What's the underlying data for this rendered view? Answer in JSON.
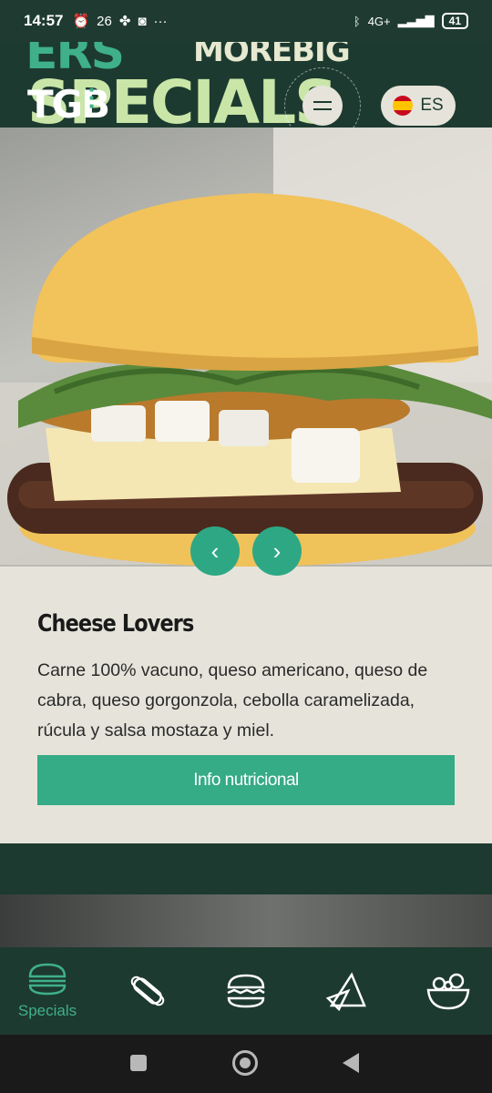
{
  "status_bar": {
    "time": "14:57",
    "temperature": "26",
    "network": "4G+",
    "battery": "41"
  },
  "header": {
    "banner_line1_left": "ERS",
    "banner_line1_right": "MOREBIG",
    "banner_line2": "SPECIALS",
    "logo": "TGB",
    "menu_ring_text": "menu",
    "language": "ES"
  },
  "product": {
    "name": "Cheese Lovers",
    "description": "Carne 100% vacuno, queso americano, queso de cabra, queso gorgonzola, cebolla caramelizada, rúcula y salsa mostaza y miel.",
    "nutrition_button": "Info nutricional"
  },
  "tabbar": {
    "tabs": [
      {
        "label": "Specials",
        "icon": "burger-icon",
        "active": true
      },
      {
        "label": "",
        "icon": "hotdog-icon",
        "active": false
      },
      {
        "label": "",
        "icon": "burger-icon",
        "active": false
      },
      {
        "label": "",
        "icon": "nachos-icon",
        "active": false
      },
      {
        "label": "",
        "icon": "salad-icon",
        "active": false
      }
    ]
  },
  "colors": {
    "brand_dark": "#1d3a30",
    "brand_green": "#35ab86",
    "card_bg": "#e6e4da"
  }
}
